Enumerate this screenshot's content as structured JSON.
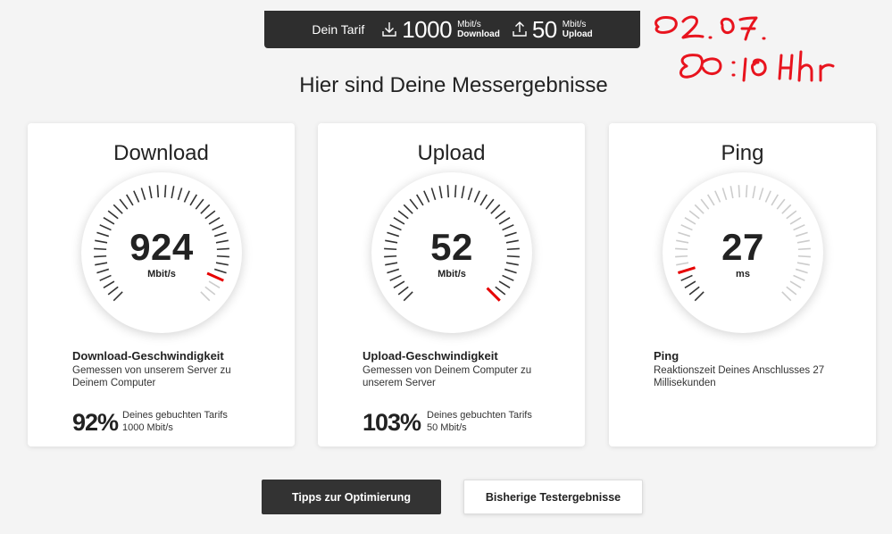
{
  "tariff": {
    "label": "Dein Tarif",
    "download_value": "1000",
    "download_unit": "Mbit/s",
    "download_label": "Download",
    "upload_value": "50",
    "upload_unit": "Mbit/s",
    "upload_label": "Upload"
  },
  "handwritten_note": [
    "02.07.",
    "00:10 Uhr"
  ],
  "page_title": "Hier sind Deine Messergebnisse",
  "cards": [
    {
      "title": "Download",
      "value": "924",
      "unit": "Mbit/s",
      "gauge_fraction": 0.924,
      "heading": "Download-Geschwindigkeit",
      "description": "Gemessen von unserem Server zu Deinem Computer",
      "percent": "92%",
      "tariff_line1": "Deines gebuchten Tarifs",
      "tariff_line2": "1000 Mbit/s"
    },
    {
      "title": "Upload",
      "value": "52",
      "unit": "Mbit/s",
      "gauge_fraction": 1.0,
      "heading": "Upload-Geschwindigkeit",
      "description": "Gemessen von Deinem Computer zu unserem Server",
      "percent": "103%",
      "tariff_line1": "Deines gebuchten Tarifs",
      "tariff_line2": "50 Mbit/s"
    },
    {
      "title": "Ping",
      "value": "27",
      "unit": "ms",
      "gauge_fraction": 0.1,
      "heading": "Ping",
      "description": "Reaktionszeit Deines Anschlusses 27 Millisekunden",
      "percent": "",
      "tariff_line1": "",
      "tariff_line2": ""
    }
  ],
  "buttons": {
    "tips": "Tipps zur Optimierung",
    "history": "Bisherige Testergebnisse"
  },
  "colors": {
    "accent": "#e60000",
    "dark": "#333333",
    "tick": "#333333",
    "tick_light": "#cccccc"
  }
}
